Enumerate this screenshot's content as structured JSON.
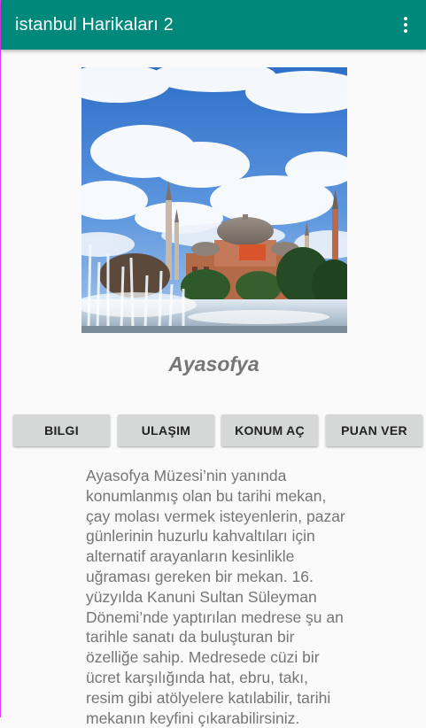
{
  "appbar": {
    "title": "istanbul Harikaları 2",
    "menu_icon": "more-vert-icon"
  },
  "colors": {
    "primary": "#00897b",
    "button_bg": "#d6d7d7",
    "text_secondary": "#757575"
  },
  "place": {
    "image_icon": "hagia-sophia-photo",
    "name": "Ayasofya"
  },
  "buttons": {
    "info": "BILGI",
    "transport": "ULAŞIM",
    "location": "KONUM AÇ",
    "rate": "PUAN VER"
  },
  "description": "Ayasofya Müzesi’nin yanında konumlanmış olan bu tarihi mekan, çay molası vermek isteyenlerin, pazar günlerinin huzurlu kahvaltıları için alternatif arayanların kesinlikle uğraması gereken bir mekan. 16. yüzyılda Kanuni Sultan Süleyman Dönemi’nde yaptırılan medrese şu an tarihle sanatı da buluşturan bir özelliğe sahip. Medresede cüzi bir ücret karşılığında hat, ebru, takı, resim gibi atölyelere katılabilir, tarihi mekanın keyfini çıkarabilirsiniz."
}
